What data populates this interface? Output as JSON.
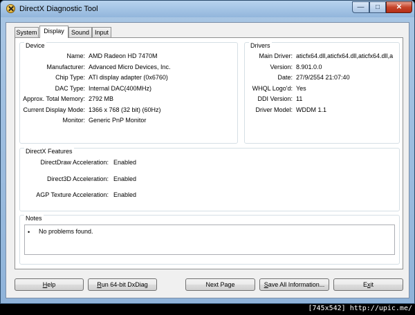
{
  "window": {
    "title": "DirectX Diagnostic Tool",
    "minimize_glyph": "—",
    "maximize_glyph": "□",
    "close_glyph": "✕"
  },
  "tabs": [
    {
      "label": "System",
      "active": false
    },
    {
      "label": "Display",
      "active": true
    },
    {
      "label": "Sound",
      "active": false
    },
    {
      "label": "Input",
      "active": false
    }
  ],
  "device": {
    "title": "Device",
    "rows": [
      {
        "label": "Name:",
        "value": "AMD Radeon HD 7470M"
      },
      {
        "label": "Manufacturer:",
        "value": "Advanced Micro Devices, Inc."
      },
      {
        "label": "Chip Type:",
        "value": "ATI display adapter (0x6760)"
      },
      {
        "label": "DAC Type:",
        "value": "Internal DAC(400MHz)"
      },
      {
        "label": "Approx. Total Memory:",
        "value": "2792 MB"
      },
      {
        "label": "Current Display Mode:",
        "value": "1366 x 768 (32 bit) (60Hz)"
      },
      {
        "label": "Monitor:",
        "value": "Generic PnP Monitor"
      }
    ]
  },
  "drivers": {
    "title": "Drivers",
    "rows": [
      {
        "label": "Main Driver:",
        "value": "aticfx64.dll,aticfx64.dll,aticfx64.dll,a"
      },
      {
        "label": "Version:",
        "value": "8.901.0.0"
      },
      {
        "label": "Date:",
        "value": "27/9/2554 21:07:40"
      },
      {
        "label": "WHQL Logo'd:",
        "value": "Yes"
      },
      {
        "label": "DDI Version:",
        "value": "11"
      },
      {
        "label": "Driver Model:",
        "value": "WDDM 1.1"
      }
    ]
  },
  "features": {
    "title": "DirectX Features",
    "rows": [
      {
        "label": "DirectDraw Acceleration:",
        "value": "Enabled"
      },
      {
        "label": "Direct3D Acceleration:",
        "value": "Enabled"
      },
      {
        "label": "AGP Texture Acceleration:",
        "value": "Enabled"
      }
    ]
  },
  "notes": {
    "title": "Notes",
    "bullet": "•",
    "items": [
      "No problems found."
    ]
  },
  "buttons": {
    "help": {
      "mnemonic": "H",
      "rest": "elp"
    },
    "run64": {
      "mnemonic": "R",
      "rest": "un 64-bit DxDiag"
    },
    "next": {
      "label": "Next Page"
    },
    "save": {
      "mnemonic": "S",
      "rest": "ave All Information..."
    },
    "exit": {
      "pre": "E",
      "mnemonic": "x",
      "rest": "it"
    }
  },
  "caption": "[745x542] http://upic.me/"
}
